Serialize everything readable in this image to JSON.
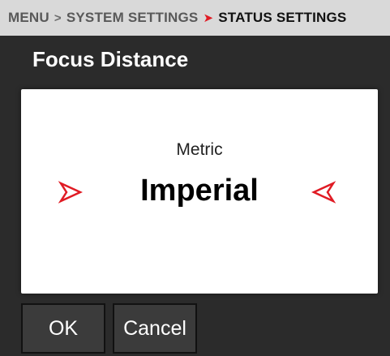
{
  "breadcrumb": {
    "items": [
      "MENU",
      "SYSTEM SETTINGS",
      "STATUS SETTINGS"
    ],
    "separator_icon": "chevron-right-icon",
    "current_separator_color": "#e01b24"
  },
  "title": "Focus Distance",
  "picker": {
    "options_visible": [
      "Metric",
      "Imperial"
    ],
    "previous": "Metric",
    "selected": "Imperial",
    "left_arrow_icon": "red-arrow-right-icon",
    "right_arrow_icon": "red-arrow-left-icon",
    "arrow_color": "#e01b24"
  },
  "buttons": {
    "ok": "OK",
    "cancel": "Cancel"
  }
}
